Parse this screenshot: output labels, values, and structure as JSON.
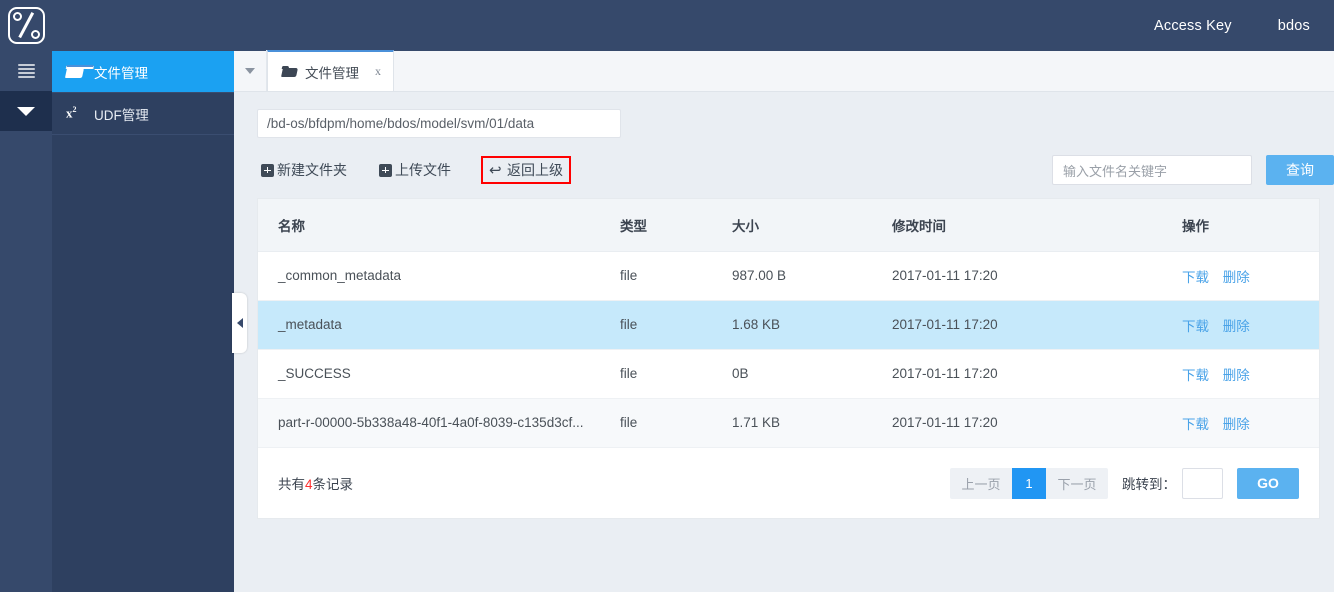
{
  "header": {
    "logo_name": "percent-logo",
    "access_key_label": "Access Key",
    "user_label": "bdos"
  },
  "rail": {
    "menu_toggle": "hamburger-icon",
    "collapse_toggle": "caret-down-icon"
  },
  "sidebar": {
    "items": [
      {
        "label": "文件管理",
        "icon": "folder-icon",
        "active": true
      },
      {
        "label": "UDF管理",
        "icon": "x-squared-icon",
        "active": false
      }
    ]
  },
  "tabstrip": {
    "dropdown_icon": "chevron-down-icon",
    "tabs": [
      {
        "label": "文件管理",
        "icon": "folder-icon",
        "close": "x"
      }
    ]
  },
  "path": {
    "value": "/bd-os/bfdpm/home/bdos/model/svm/01/data"
  },
  "toolbar": {
    "new_folder_label": "新建文件夹",
    "upload_label": "上传文件",
    "back_label": "返回上级",
    "back_icon": "back-arrow-icon",
    "highlight_color": "#ff0000"
  },
  "search": {
    "placeholder": "输入文件名关键字",
    "value": "",
    "button_label": "查询"
  },
  "table": {
    "columns": [
      "名称",
      "类型",
      "大小",
      "修改时间",
      "操作"
    ],
    "actions": {
      "download": "下载",
      "delete": "删除"
    },
    "rows": [
      {
        "name": "_common_metadata",
        "type": "file",
        "size": "987.00 B",
        "mtime": "2017-01-11 17:20",
        "state": "normal"
      },
      {
        "name": "_metadata",
        "type": "file",
        "size": "1.68 KB",
        "mtime": "2017-01-11 17:20",
        "state": "selected"
      },
      {
        "name": "_SUCCESS",
        "type": "file",
        "size": "0B",
        "mtime": "2017-01-11 17:20",
        "state": "normal"
      },
      {
        "name": "part-r-00000-5b338a48-40f1-4a0f-8039-c135d3cf...",
        "type": "file",
        "size": "1.71 KB",
        "mtime": "2017-01-11 17:20",
        "state": "striped"
      }
    ]
  },
  "pagination": {
    "total_prefix": "共有",
    "total_count": "4",
    "total_suffix": "条记录",
    "prev_label": "上一页",
    "current_page": "1",
    "next_label": "下一页",
    "jump_label": "跳转到：",
    "jump_value": "",
    "go_label": "GO"
  },
  "colors": {
    "header_bg": "#36496b",
    "sidebar_bg": "#2e4060",
    "accent": "#1ba1f2",
    "selected_row": "#c6e9fb",
    "link": "#4aa3e8",
    "danger": "#ff2d2d"
  }
}
